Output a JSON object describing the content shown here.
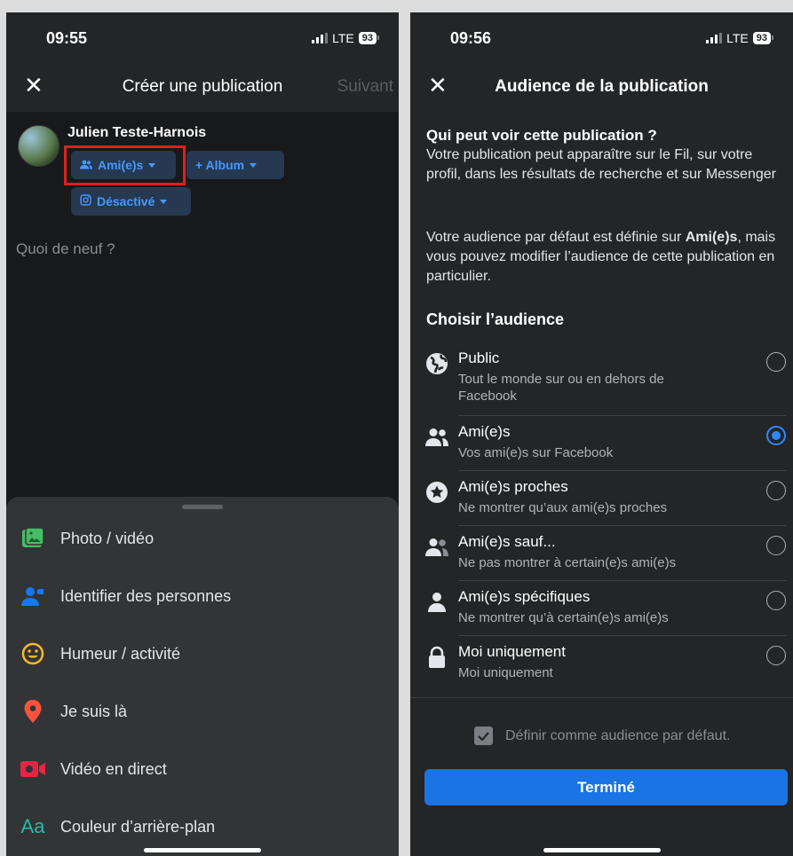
{
  "left": {
    "status": {
      "time": "09:55",
      "network": "LTE",
      "battery": "93"
    },
    "nav": {
      "close": "✕",
      "title": "Créer une publication",
      "next": "Suivant"
    },
    "composer": {
      "user_name": "Julien Teste-Harnois",
      "audience_chip": "Ami(e)s",
      "album_chip": "+ Album",
      "instagram_chip": "Désactivé",
      "placeholder": "Quoi de neuf ?"
    },
    "actions": [
      {
        "label": "Photo / vidéo",
        "icon": "photo-icon",
        "color": "#45bd62"
      },
      {
        "label": "Identifier des personnes",
        "icon": "tag-people-icon",
        "color": "#1877f2"
      },
      {
        "label": "Humeur / activité",
        "icon": "smiley-icon",
        "color": "#f7b928"
      },
      {
        "label": "Je suis là",
        "icon": "location-pin-icon",
        "color": "#f5533d"
      },
      {
        "label": "Vidéo en direct",
        "icon": "live-video-icon",
        "color": "#e42645"
      },
      {
        "label": "Couleur d’arrière-plan",
        "icon": "text-background-icon",
        "color": "#2abba7"
      }
    ],
    "actions_icon_text": "Aa"
  },
  "right": {
    "status": {
      "time": "09:56",
      "network": "LTE",
      "battery": "93"
    },
    "nav": {
      "close": "✕",
      "title": "Audience de la publication"
    },
    "intro": {
      "heading": "Qui peut voir cette publication ?",
      "text": "Votre publication peut apparaître sur le Fil, sur votre profil, dans les résultats de recherche et sur Messenger"
    },
    "default_note": {
      "prefix": "Votre audience par défaut est définie sur ",
      "bold": "Ami(e)s",
      "suffix": ", mais vous pouvez modifier l’audience de cette publication en particulier."
    },
    "choose_heading": "Choisir l’audience",
    "options": [
      {
        "title": "Public",
        "subtitle": "Tout le monde sur ou en dehors de Facebook",
        "icon": "globe-icon",
        "selected": false
      },
      {
        "title": "Ami(e)s",
        "subtitle": "Vos ami(e)s sur Facebook",
        "icon": "friends-icon",
        "selected": true
      },
      {
        "title": "Ami(e)s proches",
        "subtitle": "Ne montrer qu’aux ami(e)s proches",
        "icon": "star-icon",
        "selected": false
      },
      {
        "title": "Ami(e)s sauf...",
        "subtitle": "Ne pas montrer à certain(e)s ami(e)s",
        "icon": "friends-except-icon",
        "selected": false
      },
      {
        "title": "Ami(e)s spécifiques",
        "subtitle": "Ne montrer qu’à certain(e)s ami(e)s",
        "icon": "person-icon",
        "selected": false
      },
      {
        "title": "Moi uniquement",
        "subtitle": "Moi uniquement",
        "icon": "lock-icon",
        "selected": false
      }
    ],
    "set_default_label": "Définir comme audience par défaut.",
    "set_default_checked": true,
    "done_label": "Terminé"
  }
}
